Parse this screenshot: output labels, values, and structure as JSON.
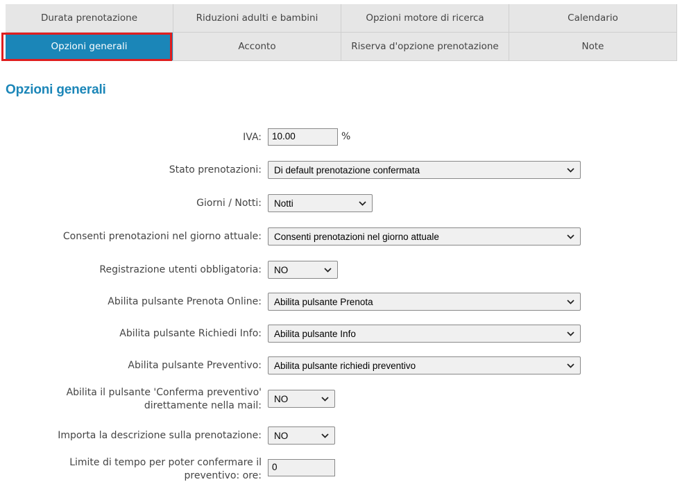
{
  "tabs": [
    {
      "label": "Durata prenotazione",
      "active": false
    },
    {
      "label": "Riduzioni adulti e bambini",
      "active": false
    },
    {
      "label": "Opzioni motore di ricerca",
      "active": false
    },
    {
      "label": "Calendario",
      "active": false
    },
    {
      "label": "Opzioni generali",
      "active": true
    },
    {
      "label": "Acconto",
      "active": false
    },
    {
      "label": "Riserva d'opzione prenotazione",
      "active": false
    },
    {
      "label": "Note",
      "active": false
    }
  ],
  "page_title": "Opzioni generali",
  "form": {
    "iva": {
      "label": "IVA:",
      "value": "10.00",
      "unit": "%"
    },
    "stato_prenotazioni": {
      "label": "Stato prenotazioni:",
      "value": "Di default prenotazione confermata"
    },
    "giorni_notti": {
      "label": "Giorni / Notti:",
      "value": "Notti"
    },
    "consenti_giorno_attuale": {
      "label": "Consenti prenotazioni nel giorno attuale:",
      "value": "Consenti prenotazioni nel giorno attuale"
    },
    "registrazione_obbligatoria": {
      "label": "Registrazione utenti obbligatoria:",
      "value": "NO"
    },
    "pulsante_prenota": {
      "label": "Abilita pulsante Prenota Online:",
      "value": "Abilita pulsante Prenota"
    },
    "pulsante_info": {
      "label": "Abilita pulsante Richiedi Info:",
      "value": "Abilita pulsante Info"
    },
    "pulsante_preventivo": {
      "label": "Abilita pulsante Preventivo:",
      "value": "Abilita pulsante richiedi preventivo"
    },
    "conferma_preventivo_mail": {
      "label": "Abilita il pulsante 'Conferma preventivo' direttamente nella mail:",
      "value": "NO"
    },
    "importa_descrizione": {
      "label": "Importa la descrizione sulla prenotazione:",
      "value": "NO"
    },
    "limite_tempo": {
      "label": "Limite di tempo per poter confermare il preventivo: ore:",
      "value": "0"
    }
  },
  "colors": {
    "accent": "#1b86b8",
    "highlight": "#e01e1e"
  }
}
